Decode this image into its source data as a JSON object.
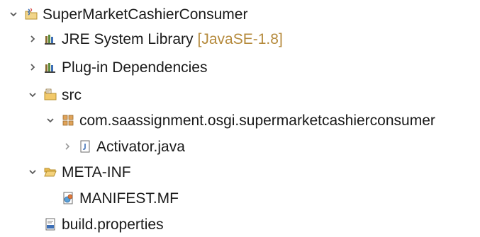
{
  "tree": {
    "project": {
      "label": "SuperMarketCashierConsumer",
      "icon": "java-project-icon"
    },
    "jre": {
      "label": "JRE System Library",
      "decoration": "[JavaSE-1.8]",
      "icon": "library-icon"
    },
    "plugin_deps": {
      "label": "Plug-in Dependencies",
      "icon": "library-icon"
    },
    "src": {
      "label": "src",
      "icon": "source-folder-icon"
    },
    "package": {
      "label": "com.saassignment.osgi.supermarketcashierconsumer",
      "icon": "package-icon"
    },
    "activator": {
      "label": "Activator.java",
      "icon": "java-file-icon"
    },
    "meta_inf": {
      "label": "META-INF",
      "icon": "folder-open-icon"
    },
    "manifest": {
      "label": "MANIFEST.MF",
      "icon": "manifest-file-icon"
    },
    "build_properties": {
      "label": "build.properties",
      "icon": "properties-file-icon"
    }
  },
  "colors": {
    "decoration": "#b58a3c",
    "text": "#1a1a1a",
    "twisty": "#5a5a5a"
  }
}
